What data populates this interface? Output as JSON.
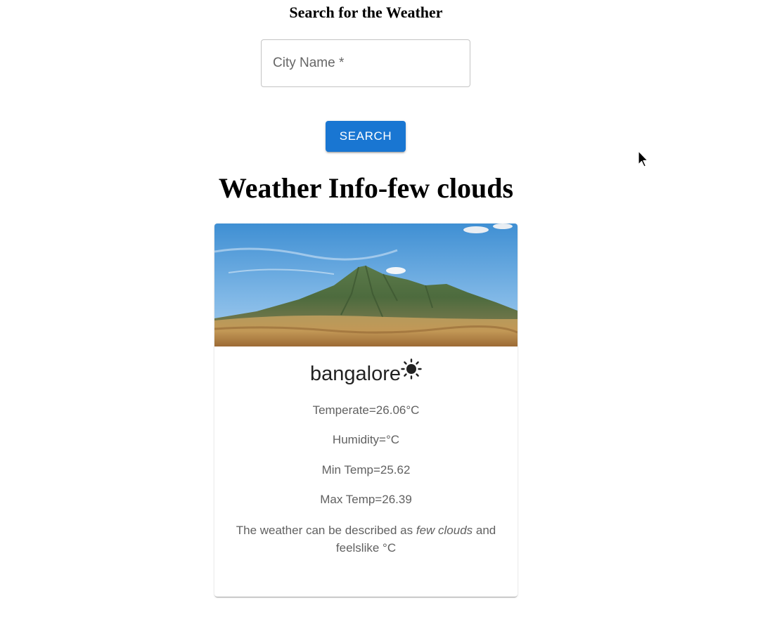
{
  "search": {
    "title": "Search for the Weather",
    "input_label": "City Name",
    "required_mark": " *",
    "input_value": "",
    "button_label": "SEARCH"
  },
  "weather": {
    "heading": "Weather Info-few clouds",
    "city": "bangalore",
    "icon": "sun-icon",
    "temperature": "Temperate=26.06°C",
    "humidity": "Humidity=°C",
    "min_temp": "Min Temp=25.62",
    "max_temp": "Max Temp=26.39",
    "description_prefix": "The weather can be described as ",
    "description_condition": "few clouds",
    "description_suffix": " and feelslike °C"
  },
  "colors": {
    "button": "#1976d2",
    "secondary_text": "#616161"
  }
}
